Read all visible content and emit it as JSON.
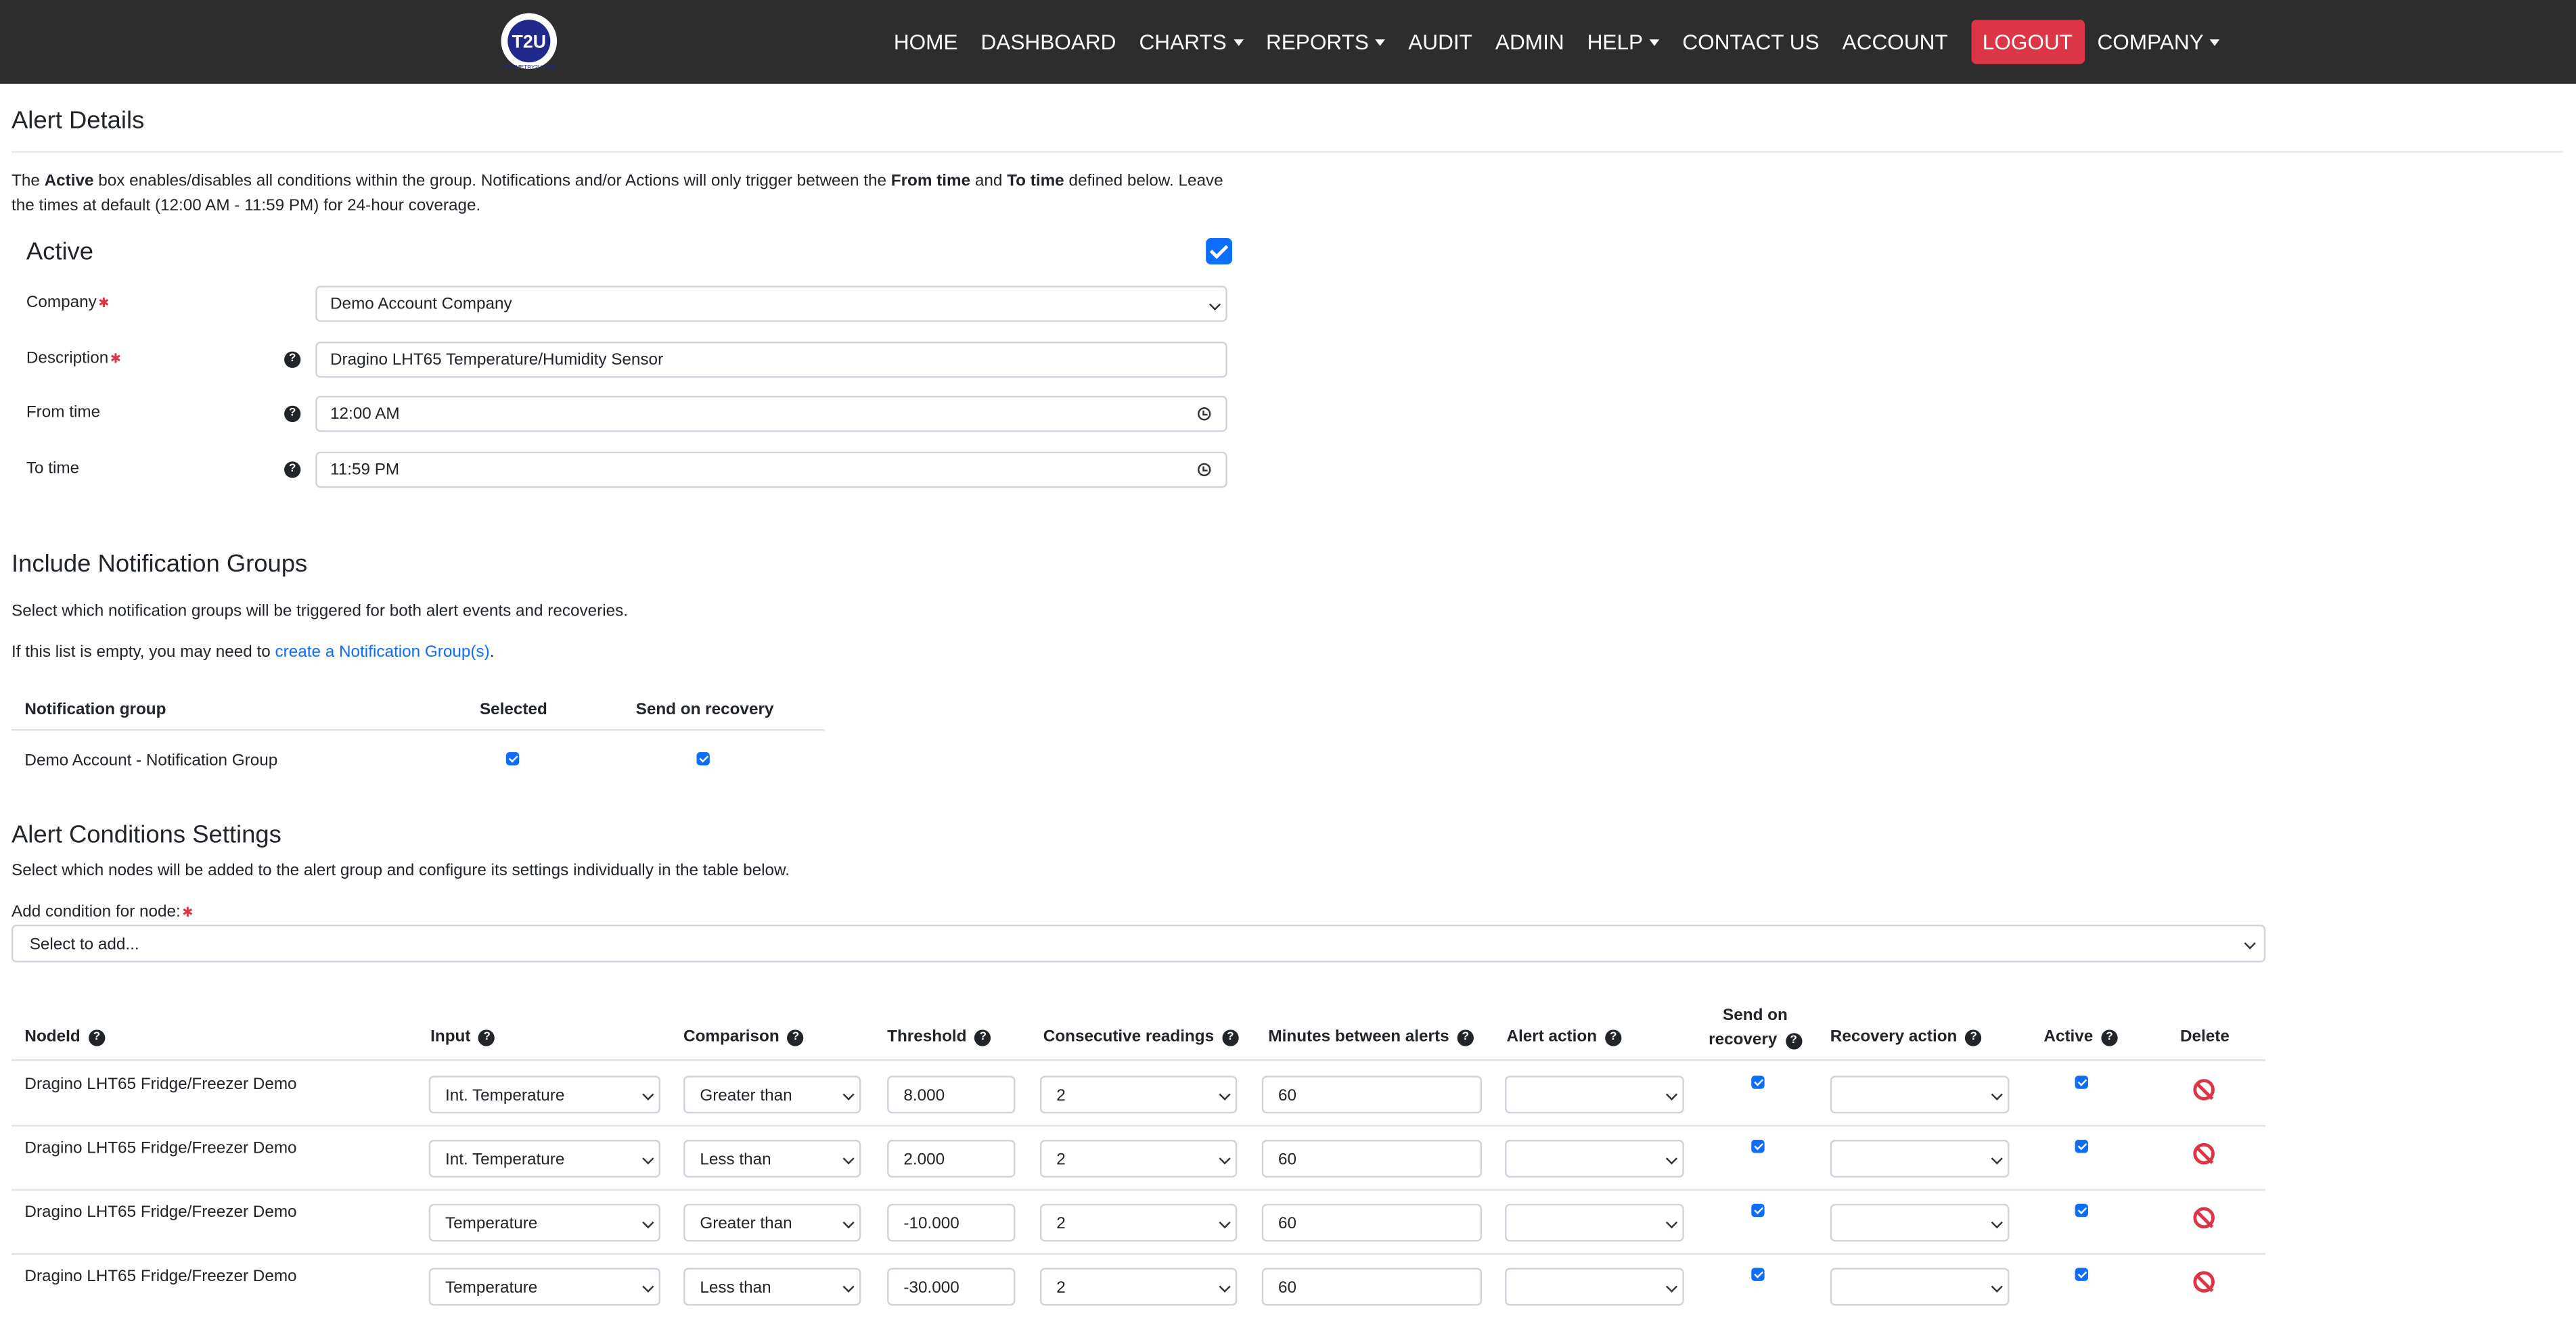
{
  "nav": {
    "logo_text": "T2U",
    "logo_ring": "TELEMETRY2U.COM",
    "items": [
      {
        "label": "HOME",
        "dropdown": false
      },
      {
        "label": "DASHBOARD",
        "dropdown": false
      },
      {
        "label": "CHARTS",
        "dropdown": true
      },
      {
        "label": "REPORTS",
        "dropdown": true
      },
      {
        "label": "AUDIT",
        "dropdown": false
      },
      {
        "label": "ADMIN",
        "dropdown": false
      },
      {
        "label": "HELP",
        "dropdown": true
      },
      {
        "label": "CONTACT US",
        "dropdown": false
      },
      {
        "label": "ACCOUNT",
        "dropdown": false
      }
    ],
    "logout": "LOGOUT",
    "company": "COMPANY"
  },
  "page": {
    "title": "Alert Details",
    "intro": {
      "t1": "The ",
      "b1": "Active",
      "t2": " box enables/disables all conditions within the group. Notifications and/or Actions will only trigger between the ",
      "b2": "From time",
      "t3": " and ",
      "b3": "To time",
      "t4": " defined below. Leave the times at default (12:00 AM - 11:59 PM) for 24-hour coverage."
    },
    "active_label": "Active",
    "active_checked": true
  },
  "form": {
    "company": {
      "label": "Company",
      "value": "Demo Account Company",
      "required": true
    },
    "description": {
      "label": "Description",
      "value": "Dragino LHT65 Temperature/Humidity Sensor",
      "required": true
    },
    "from_time": {
      "label": "From time",
      "value": "12:00  AM"
    },
    "to_time": {
      "label": "To time",
      "value": "11:59  PM"
    }
  },
  "notification_groups": {
    "title": "Include Notification Groups",
    "desc": "Select which notification groups will be triggered for both alert events and recoveries.",
    "empty_text": "If this list is empty, you may need to ",
    "link_text": "create a Notification Group(s)",
    "after_link": ".",
    "headers": {
      "group": "Notification group",
      "selected": "Selected",
      "recovery": "Send on recovery"
    },
    "rows": [
      {
        "group": "Demo Account - Notification Group",
        "selected": true,
        "recovery": true
      }
    ]
  },
  "conditions": {
    "title": "Alert Conditions Settings",
    "desc": "Select which nodes will be added to the alert group and configure its settings individually in the table below.",
    "add_label": "Add condition for node:",
    "add_placeholder": "Select to add...",
    "headers": {
      "node": "NodeId",
      "input": "Input",
      "comparison": "Comparison",
      "threshold": "Threshold",
      "consecutive": "Consecutive readings",
      "minutes": "Minutes between alerts",
      "alert_action": "Alert action",
      "send_recovery_1": "Send on",
      "send_recovery_2": "recovery",
      "recovery_action": "Recovery action",
      "active": "Active",
      "delete": "Delete"
    },
    "rows": [
      {
        "node": "Dragino LHT65 Fridge/Freezer Demo",
        "input": "Int. Temperature",
        "comparison": "Greater than",
        "threshold": "8.000",
        "consecutive": "2",
        "minutes": "60",
        "alert_action": "",
        "send_recovery": true,
        "recovery_action": "",
        "active": true
      },
      {
        "node": "Dragino LHT65 Fridge/Freezer Demo",
        "input": "Int. Temperature",
        "comparison": "Less than",
        "threshold": "2.000",
        "consecutive": "2",
        "minutes": "60",
        "alert_action": "",
        "send_recovery": true,
        "recovery_action": "",
        "active": true
      },
      {
        "node": "Dragino LHT65 Fridge/Freezer Demo",
        "input": "Temperature",
        "comparison": "Greater than",
        "threshold": "-10.000",
        "consecutive": "2",
        "minutes": "60",
        "alert_action": "",
        "send_recovery": true,
        "recovery_action": "",
        "active": true
      },
      {
        "node": "Dragino LHT65 Fridge/Freezer Demo",
        "input": "Temperature",
        "comparison": "Less than",
        "threshold": "-30.000",
        "consecutive": "2",
        "minutes": "60",
        "alert_action": "",
        "send_recovery": true,
        "recovery_action": "",
        "active": true
      }
    ]
  },
  "colors": {
    "nav_bg": "#2d2d2d",
    "logout_bg": "#dc3545",
    "checkbox": "#0d6efd",
    "delete_icon": "#dc3545",
    "link": "#0d6efd"
  }
}
